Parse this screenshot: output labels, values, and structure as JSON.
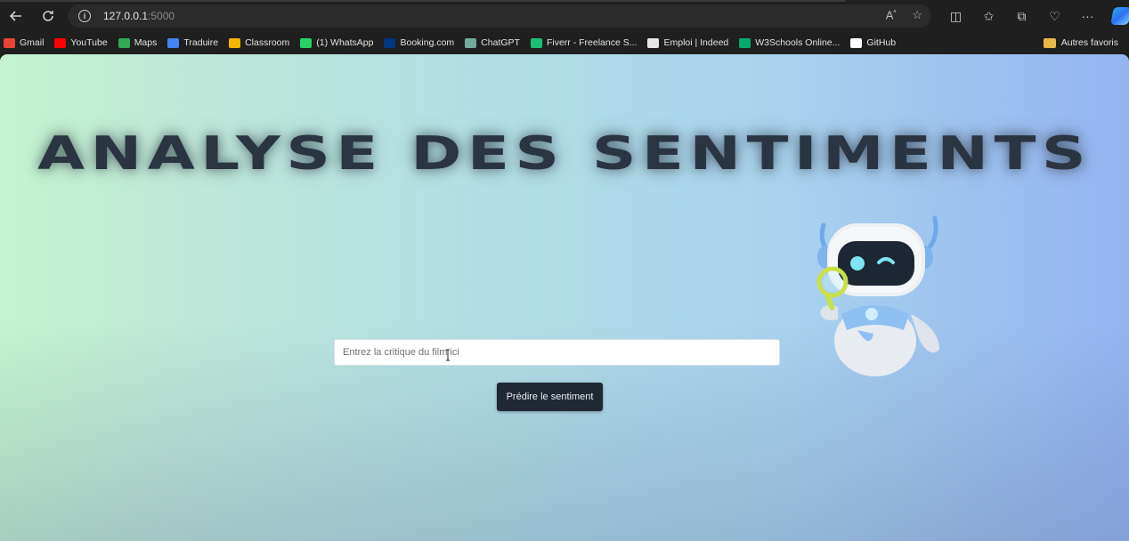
{
  "browser": {
    "url_host": "127.0.0.1",
    "url_port": ":5000"
  },
  "bookmarks": [
    {
      "label": "Gmail",
      "icon": "gmail-icon",
      "color": "#ea4335"
    },
    {
      "label": "YouTube",
      "icon": "youtube-icon",
      "color": "#ff0000"
    },
    {
      "label": "Maps",
      "icon": "maps-icon",
      "color": "#34a853"
    },
    {
      "label": "Traduire",
      "icon": "translate-icon",
      "color": "#4285f4"
    },
    {
      "label": "Classroom",
      "icon": "classroom-icon",
      "color": "#f4b400"
    },
    {
      "label": "(1) WhatsApp",
      "icon": "whatsapp-icon",
      "color": "#25d366"
    },
    {
      "label": "Booking.com",
      "icon": "booking-icon",
      "color": "#003580"
    },
    {
      "label": "ChatGPT",
      "icon": "chatgpt-icon",
      "color": "#74aa9c"
    },
    {
      "label": "Fiverr - Freelance S...",
      "icon": "fiverr-icon",
      "color": "#1dbf73"
    },
    {
      "label": "Emploi | Indeed",
      "icon": "indeed-icon",
      "color": "#e6e6e6"
    },
    {
      "label": "W3Schools Online...",
      "icon": "w3schools-icon",
      "color": "#04aa6d"
    },
    {
      "label": "GitHub",
      "icon": "github-icon",
      "color": "#ffffff"
    }
  ],
  "other_favorites": "Autres favoris",
  "page": {
    "title": "Analyse des sentiments",
    "input_placeholder": "Entrez la critique du film ici",
    "button_label": "Prédire le sentiment"
  }
}
